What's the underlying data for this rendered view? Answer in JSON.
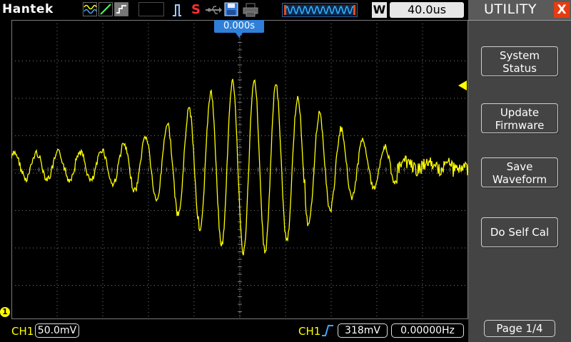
{
  "brand": "Hantek",
  "toolbar": {
    "icons": [
      "wave-mode-icon",
      "ramp-icon",
      "acquire-icon",
      "run-icon",
      "stop-s-icon",
      "usb-icon",
      "save-disk-icon",
      "print-icon"
    ],
    "run_state": "S",
    "mode_letter": "W",
    "timebase": "40.0us"
  },
  "screen": {
    "trigger_time": "0.000s",
    "ch1_marker": "1",
    "trace_color": "#ffff00",
    "grid_color": "#7a7a7a"
  },
  "status": {
    "ch1_label": "CH1",
    "ch1_scale": "50.0mV",
    "trigger_source": "CH1",
    "trigger_level": "318mV",
    "frequency": "0.00000Hz"
  },
  "menu": {
    "title": "UTILITY",
    "close_glyph": "X",
    "buttons": [
      {
        "lines": [
          "System",
          "Status"
        ]
      },
      {
        "lines": [
          "Update",
          "Firmware"
        ]
      },
      {
        "lines": [
          "Save",
          "Waveform"
        ]
      },
      {
        "lines": [
          "Do Self Cal"
        ]
      }
    ],
    "page": "Page 1/4"
  }
}
